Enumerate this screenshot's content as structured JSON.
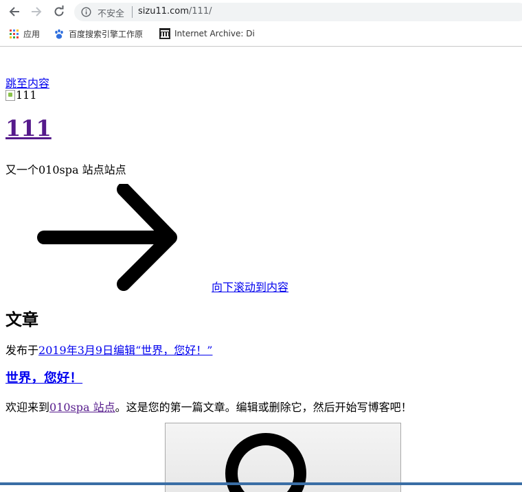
{
  "browser": {
    "security_label": "不安全",
    "url_host": "sizu11.com",
    "url_path": "/111/"
  },
  "bookmarks": [
    {
      "label": "应用",
      "icon": "apps-grid-icon"
    },
    {
      "label": "百度搜索引擎工作原",
      "icon": "baidu-paw-icon"
    },
    {
      "label": "Internet Archive: Di",
      "icon": "archive-icon"
    }
  ],
  "page": {
    "skip_link": "跳至内容",
    "header_image_alt": "111",
    "site_title": "111",
    "site_description": "又一个010spa 站点站点",
    "scroll_link": "向下滚动到内容",
    "section_heading": "文章",
    "post_meta_prefix": "发布于",
    "post_date_link": "2019年3月9日",
    "post_edit_link": "编辑“世界，您好！”",
    "post_title": "世界，您好！",
    "excerpt_prefix": "欢迎来到",
    "excerpt_link": "010spa 站点",
    "excerpt_suffix": "。这是您的第一篇文章。编辑或删除它，然后开始写博客吧！"
  }
}
